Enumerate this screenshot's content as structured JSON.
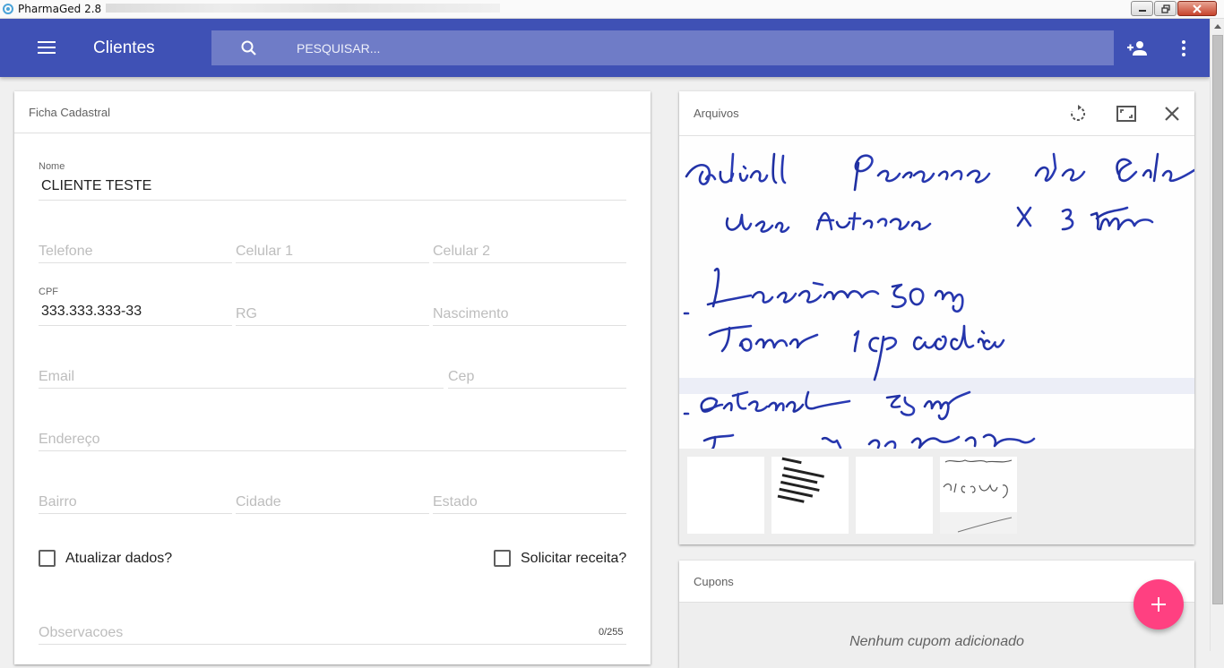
{
  "window": {
    "title": "PharmaGed 2.8"
  },
  "appbar": {
    "title": "Clientes",
    "search_placeholder": "PESQUISAR...",
    "menu_icon": "hamburger-menu-icon",
    "add_icon": "person-add-icon",
    "more_icon": "more-vertical-icon",
    "color": "#3f51b5"
  },
  "ficha": {
    "title": "Ficha Cadastral",
    "nome": {
      "label": "Nome",
      "value": "CLIENTE TESTE"
    },
    "telefone": {
      "placeholder": "Telefone"
    },
    "celular1": {
      "placeholder": "Celular 1"
    },
    "celular2": {
      "placeholder": "Celular 2"
    },
    "cpf": {
      "label": "CPF",
      "value": "333.333.333-33"
    },
    "rg": {
      "placeholder": "RG"
    },
    "nascimento": {
      "placeholder": "Nascimento"
    },
    "email": {
      "placeholder": "Email"
    },
    "cep": {
      "placeholder": "Cep"
    },
    "endereco": {
      "placeholder": "Endereço"
    },
    "bairro": {
      "placeholder": "Bairro"
    },
    "cidade": {
      "placeholder": "Cidade"
    },
    "estado": {
      "placeholder": "Estado"
    },
    "atualizar": {
      "label": "Atualizar dados?",
      "checked": false
    },
    "solicitar": {
      "label": "Solicitar receita?",
      "checked": false
    },
    "observacoes": {
      "placeholder": "Observacoes",
      "counter": "0/255"
    }
  },
  "arquivos": {
    "title": "Arquivos",
    "actions": [
      "rotate-icon",
      "fullscreen-icon",
      "close-icon"
    ],
    "thumbnail_count": 4
  },
  "cupons": {
    "title": "Cupons",
    "empty": "Nenhum cupom adicionado"
  },
  "fab": {
    "icon": "plus-icon",
    "color": "#ff4081"
  }
}
